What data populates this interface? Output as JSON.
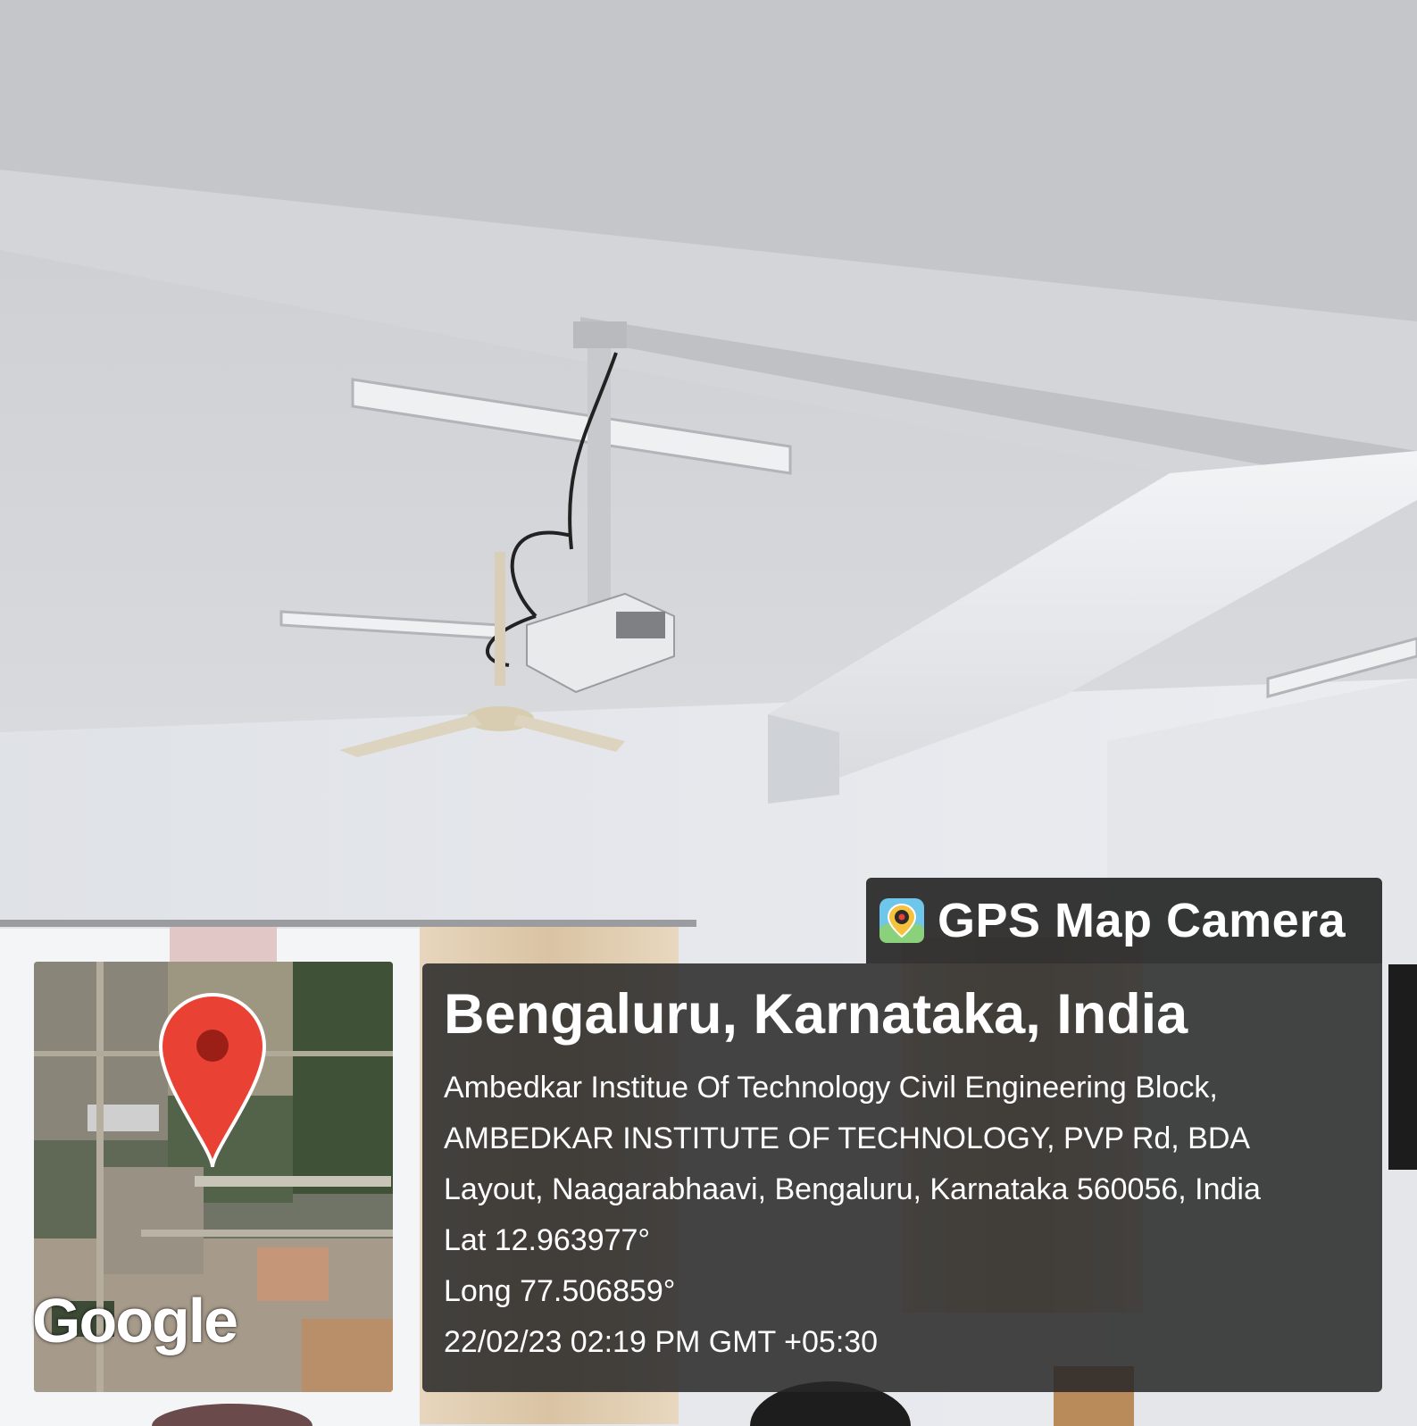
{
  "scene": {
    "description_icons": [
      "ceiling-projector",
      "ceiling-fan",
      "tube-light",
      "curtains",
      "window"
    ]
  },
  "map": {
    "logo_text": "Google",
    "pin_color": "#e94235"
  },
  "overlay": {
    "brand_title": "GPS Map Camera",
    "city": "Bengaluru, Karnataka, India",
    "address_lines": [
      "Ambedkar Institue Of Technology Civil Engineering Block,",
      "AMBEDKAR INSTITUTE OF TECHNOLOGY, PVP Rd, BDA",
      "Layout, Naagarabhaavi, Bengaluru, Karnataka 560056, India"
    ],
    "lat": "Lat 12.963977°",
    "long": "Long 77.506859°",
    "timestamp": "22/02/23 02:19 PM GMT +05:30"
  }
}
